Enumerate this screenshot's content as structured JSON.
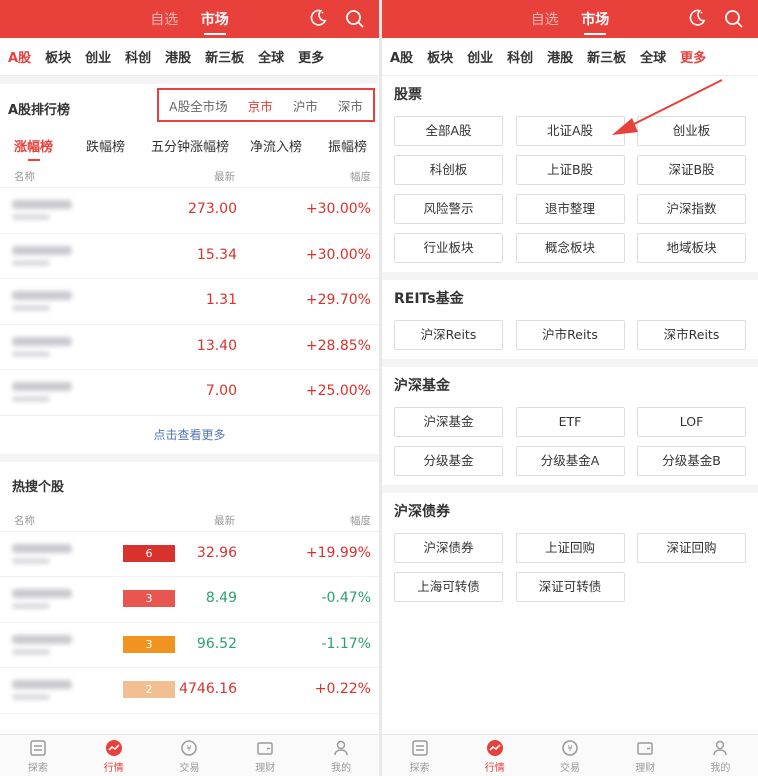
{
  "header": {
    "tab_watchlist": "自选",
    "tab_market": "市场"
  },
  "categories": [
    "A股",
    "板块",
    "创业",
    "科创",
    "港股",
    "新三板",
    "全球",
    "更多"
  ],
  "left": {
    "rank_title": "A股排行榜",
    "markets": [
      "A股全市场",
      "京市",
      "沪市",
      "深市"
    ],
    "subtabs": [
      "涨幅榜",
      "跌幅榜",
      "五分钟涨幅榜",
      "净流入榜",
      "振幅榜"
    ],
    "col_name": "名称",
    "col_latest": "最新",
    "col_change": "幅度",
    "rows": [
      {
        "price": "273.00",
        "change": "+30.00%"
      },
      {
        "price": "15.34",
        "change": "+30.00%"
      },
      {
        "price": "1.31",
        "change": "+29.70%"
      },
      {
        "price": "13.40",
        "change": "+28.85%"
      },
      {
        "price": "7.00",
        "change": "+25.00%"
      }
    ],
    "more_link": "点击查看更多",
    "hot_title": "热搜个股",
    "hot_rows": [
      {
        "heat": "6",
        "heat_color": "#d9322c",
        "price": "32.96",
        "change": "+19.99%",
        "dir": "up"
      },
      {
        "heat": "3",
        "heat_color": "#e9564f",
        "price": "8.49",
        "change": "-0.47%",
        "dir": "down"
      },
      {
        "heat": "3",
        "heat_color": "#f0941f",
        "price": "96.52",
        "change": "-1.17%",
        "dir": "down"
      },
      {
        "heat": "2",
        "heat_color": "#f2bf92",
        "price": "4746.16",
        "change": "+0.22%",
        "dir": "up"
      }
    ]
  },
  "right": {
    "sections": [
      {
        "title": "股票",
        "items": [
          "全部A股",
          "北证A股",
          "创业板",
          "科创板",
          "上证B股",
          "深证B股",
          "风险警示",
          "退市整理",
          "沪深指数",
          "行业板块",
          "概念板块",
          "地域板块"
        ]
      },
      {
        "title": "REITs基金",
        "items": [
          "沪深Reits",
          "沪市Reits",
          "深市Reits"
        ]
      },
      {
        "title": "沪深基金",
        "items": [
          "沪深基金",
          "ETF",
          "LOF",
          "分级基金",
          "分级基金A",
          "分级基金B"
        ]
      },
      {
        "title": "沪深债券",
        "items": [
          "沪深债券",
          "上证回购",
          "深证回购",
          "上海可转债",
          "深证可转债"
        ]
      }
    ]
  },
  "nav": [
    "探索",
    "行情",
    "交易",
    "理财",
    "我的"
  ],
  "colors": {
    "brand": "#e8403b",
    "up": "#d9322c",
    "down": "#2aa36b"
  }
}
